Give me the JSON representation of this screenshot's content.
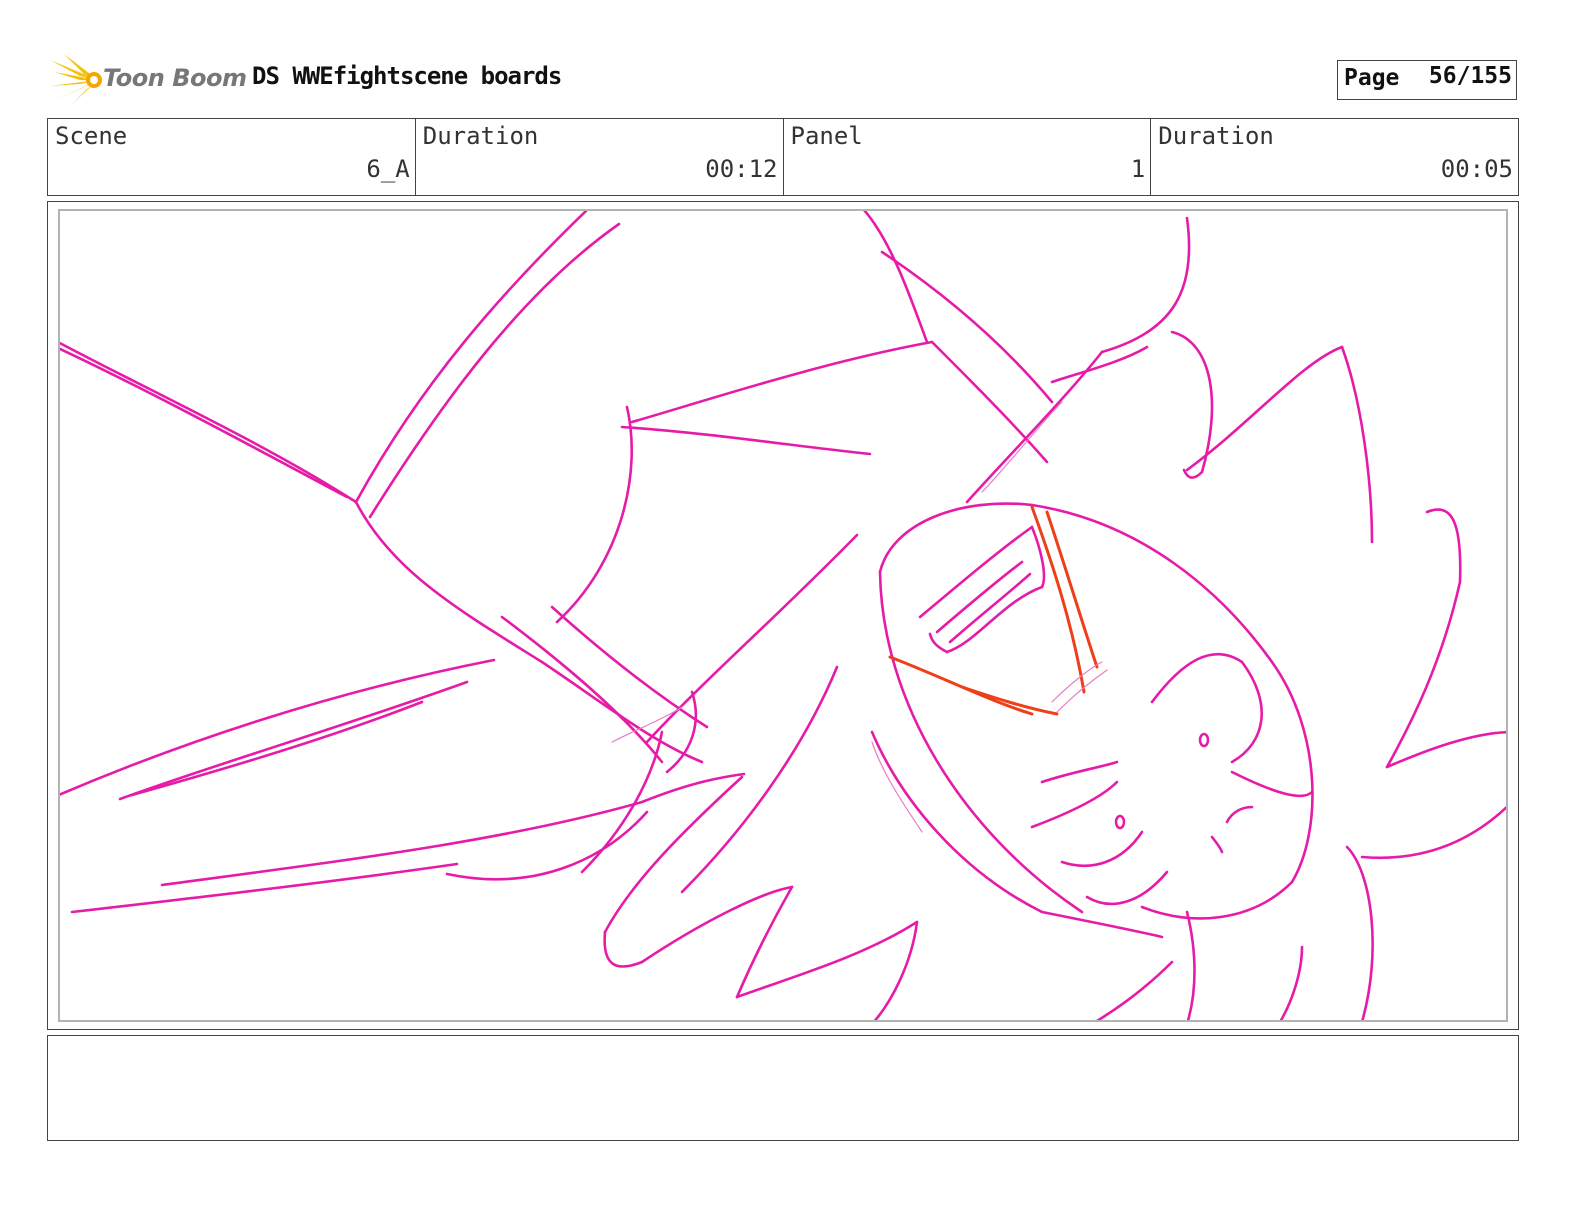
{
  "header": {
    "logo_text": "Toon Boom",
    "title": "DS WWEfightscene boards",
    "page_label": "Page",
    "page_number": "56/155"
  },
  "info": [
    {
      "label": "Scene",
      "value": "6_A"
    },
    {
      "label": "Duration",
      "value": "00:12"
    },
    {
      "label": "Panel",
      "value": "1"
    },
    {
      "label": "Duration",
      "value": "00:05"
    }
  ],
  "colors": {
    "sketch_magenta": "#e61ba8",
    "sketch_orange": "#ef3e1a",
    "logo_yellow": "#f4c20d",
    "frame_gray": "#b3b3b3"
  },
  "notes": ""
}
